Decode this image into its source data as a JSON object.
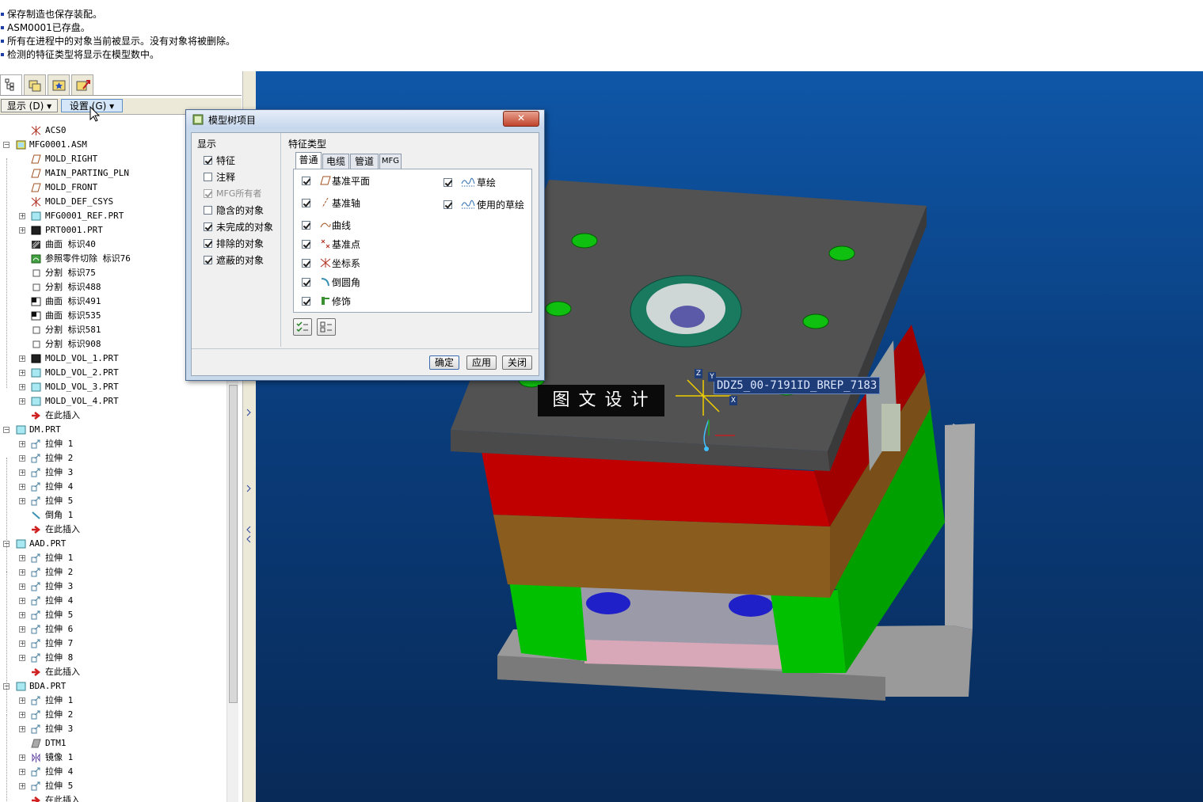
{
  "messages": [
    "保存制造也保存装配。",
    "ASM0001已存盘。",
    "所有在进程中的对象当前被显示。没有对象将被删除。",
    "检测的特征类型将显示在模型数中。"
  ],
  "navigator_tabs": [
    "model-tree-icon",
    "layers-icon",
    "favorites-icon",
    "connections-icon"
  ],
  "tree_menu": {
    "show_label": "显示 (D) ▾",
    "settings_label": "设置 (G) ▾"
  },
  "tree": [
    {
      "label": "ACS0",
      "icon": "csys",
      "level": 1,
      "exp": ""
    },
    {
      "label": "MFG0001.ASM",
      "icon": "asm",
      "level": 0,
      "exp": "-"
    },
    {
      "label": "MOLD_RIGHT",
      "icon": "plane",
      "level": 2,
      "exp": ""
    },
    {
      "label": "MAIN_PARTING_PLN",
      "icon": "plane",
      "level": 2,
      "exp": ""
    },
    {
      "label": "MOLD_FRONT",
      "icon": "plane",
      "level": 2,
      "exp": ""
    },
    {
      "label": "MOLD_DEF_CSYS",
      "icon": "csys",
      "level": 2,
      "exp": ""
    },
    {
      "label": "MFG0001_REF.PRT",
      "icon": "part",
      "level": 2,
      "exp": "+"
    },
    {
      "label": "PRT0001.PRT",
      "icon": "partdark",
      "level": 2,
      "exp": "+"
    },
    {
      "label": "曲面 标识40",
      "icon": "surface",
      "level": 2,
      "exp": ""
    },
    {
      "label": "参照零件切除 标识76",
      "icon": "cut",
      "level": 2,
      "exp": ""
    },
    {
      "label": "分割 标识75",
      "icon": "split",
      "level": 2,
      "exp": ""
    },
    {
      "label": "分割 标识488",
      "icon": "split",
      "level": 2,
      "exp": ""
    },
    {
      "label": "曲面 标识491",
      "icon": "surface2",
      "level": 2,
      "exp": ""
    },
    {
      "label": "曲面 标识535",
      "icon": "surface2",
      "level": 2,
      "exp": ""
    },
    {
      "label": "分割 标识581",
      "icon": "split",
      "level": 2,
      "exp": ""
    },
    {
      "label": "分割 标识908",
      "icon": "split",
      "level": 2,
      "exp": ""
    },
    {
      "label": "MOLD_VOL_1.PRT",
      "icon": "partdark",
      "level": 2,
      "exp": "+"
    },
    {
      "label": "MOLD_VOL_2.PRT",
      "icon": "part",
      "level": 2,
      "exp": "+"
    },
    {
      "label": "MOLD_VOL_3.PRT",
      "icon": "part",
      "level": 2,
      "exp": "+"
    },
    {
      "label": "MOLD_VOL_4.PRT",
      "icon": "part",
      "level": 2,
      "exp": "+"
    },
    {
      "label": "在此插入",
      "icon": "insert",
      "level": 2,
      "exp": ""
    },
    {
      "label": "DM.PRT",
      "icon": "part",
      "level": 0,
      "exp": "-"
    },
    {
      "label": "拉伸 1",
      "icon": "extrude",
      "level": 2,
      "exp": "+"
    },
    {
      "label": "拉伸 2",
      "icon": "extrude",
      "level": 2,
      "exp": "+"
    },
    {
      "label": "拉伸 3",
      "icon": "extrude",
      "level": 2,
      "exp": "+"
    },
    {
      "label": "拉伸 4",
      "icon": "extrude",
      "level": 2,
      "exp": "+"
    },
    {
      "label": "拉伸 5",
      "icon": "extrude",
      "level": 2,
      "exp": "+"
    },
    {
      "label": "倒角 1",
      "icon": "chamfer",
      "level": 2,
      "exp": ""
    },
    {
      "label": "在此插入",
      "icon": "insert",
      "level": 2,
      "exp": ""
    },
    {
      "label": "AAD.PRT",
      "icon": "part",
      "level": 0,
      "exp": "-"
    },
    {
      "label": "拉伸 1",
      "icon": "extrude",
      "level": 2,
      "exp": "+"
    },
    {
      "label": "拉伸 2",
      "icon": "extrude",
      "level": 2,
      "exp": "+"
    },
    {
      "label": "拉伸 3",
      "icon": "extrude",
      "level": 2,
      "exp": "+"
    },
    {
      "label": "拉伸 4",
      "icon": "extrude",
      "level": 2,
      "exp": "+"
    },
    {
      "label": "拉伸 5",
      "icon": "extrude",
      "level": 2,
      "exp": "+"
    },
    {
      "label": "拉伸 6",
      "icon": "extrude",
      "level": 2,
      "exp": "+"
    },
    {
      "label": "拉伸 7",
      "icon": "extrude",
      "level": 2,
      "exp": "+"
    },
    {
      "label": "拉伸 8",
      "icon": "extrude",
      "level": 2,
      "exp": "+"
    },
    {
      "label": "在此插入",
      "icon": "insert",
      "level": 2,
      "exp": ""
    },
    {
      "label": "BDA.PRT",
      "icon": "part",
      "level": 0,
      "exp": "-"
    },
    {
      "label": "拉伸 1",
      "icon": "extrude",
      "level": 2,
      "exp": "+"
    },
    {
      "label": "拉伸 2",
      "icon": "extrude",
      "level": 2,
      "exp": "+"
    },
    {
      "label": "拉伸 3",
      "icon": "extrude",
      "level": 2,
      "exp": "+"
    },
    {
      "label": "DTM1",
      "icon": "dtm",
      "level": 2,
      "exp": ""
    },
    {
      "label": "镜像 1",
      "icon": "mirror",
      "level": 2,
      "exp": "+"
    },
    {
      "label": "拉伸 4",
      "icon": "extrude",
      "level": 2,
      "exp": "+"
    },
    {
      "label": "拉伸 5",
      "icon": "extrude",
      "level": 2,
      "exp": "+"
    },
    {
      "label": "在此插入",
      "icon": "insert",
      "level": 2,
      "exp": ""
    }
  ],
  "dialog": {
    "title": "模型树项目",
    "close_label": "✕",
    "display_group": "显示",
    "display_items": [
      {
        "label": "特征",
        "checked": true,
        "disabled": false
      },
      {
        "label": "注释",
        "checked": false,
        "disabled": false
      },
      {
        "label": "MFG所有者",
        "checked": true,
        "disabled": true
      },
      {
        "label": "隐含的对象",
        "checked": false,
        "disabled": false
      },
      {
        "label": "未完成的对象",
        "checked": true,
        "disabled": false
      },
      {
        "label": "排除的对象",
        "checked": true,
        "disabled": false
      },
      {
        "label": "遮蔽的对象",
        "checked": true,
        "disabled": false
      }
    ],
    "feature_group": "特征类型",
    "tabs": [
      "普通",
      "电缆",
      "管道",
      "MFG"
    ],
    "features_left": [
      {
        "label": "基准平面",
        "icon": "plane"
      },
      {
        "label": "基准轴",
        "icon": "axis"
      },
      {
        "label": "曲线",
        "icon": "curve"
      },
      {
        "label": "基准点",
        "icon": "point"
      },
      {
        "label": "坐标系",
        "icon": "csys"
      },
      {
        "label": "倒圆角",
        "icon": "round"
      },
      {
        "label": "修饰",
        "icon": "cosmetic"
      }
    ],
    "features_right": [
      {
        "label": "草绘",
        "icon": "sketch"
      },
      {
        "label": "使用的草绘",
        "icon": "sketch"
      }
    ],
    "ok_label": "确定",
    "apply_label": "应用",
    "cancel_label": "关闭"
  },
  "viewport": {
    "watermark": "图 文 设 计",
    "csys_label": "DDZ5_00-7191ID_BREP_7183",
    "axis_z": "Z",
    "axis_y": "Y",
    "axis_x": "X"
  },
  "colors": {
    "viewport_top": "#0f57a8",
    "plate_dark": "#4b4b4b",
    "red": "#c80000",
    "brown": "#8a5a1e",
    "green": "#00b000",
    "gray": "#8c8c8c"
  }
}
